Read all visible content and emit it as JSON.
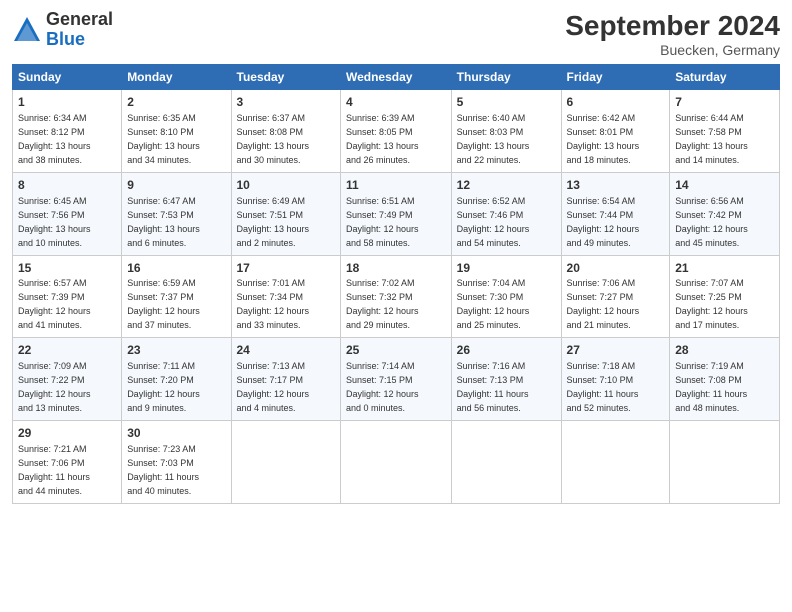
{
  "logo": {
    "general": "General",
    "blue": "Blue"
  },
  "title": "September 2024",
  "subtitle": "Buecken, Germany",
  "headers": [
    "Sunday",
    "Monday",
    "Tuesday",
    "Wednesday",
    "Thursday",
    "Friday",
    "Saturday"
  ],
  "weeks": [
    [
      {
        "day": "1",
        "info": "Sunrise: 6:34 AM\nSunset: 8:12 PM\nDaylight: 13 hours\nand 38 minutes."
      },
      {
        "day": "2",
        "info": "Sunrise: 6:35 AM\nSunset: 8:10 PM\nDaylight: 13 hours\nand 34 minutes."
      },
      {
        "day": "3",
        "info": "Sunrise: 6:37 AM\nSunset: 8:08 PM\nDaylight: 13 hours\nand 30 minutes."
      },
      {
        "day": "4",
        "info": "Sunrise: 6:39 AM\nSunset: 8:05 PM\nDaylight: 13 hours\nand 26 minutes."
      },
      {
        "day": "5",
        "info": "Sunrise: 6:40 AM\nSunset: 8:03 PM\nDaylight: 13 hours\nand 22 minutes."
      },
      {
        "day": "6",
        "info": "Sunrise: 6:42 AM\nSunset: 8:01 PM\nDaylight: 13 hours\nand 18 minutes."
      },
      {
        "day": "7",
        "info": "Sunrise: 6:44 AM\nSunset: 7:58 PM\nDaylight: 13 hours\nand 14 minutes."
      }
    ],
    [
      {
        "day": "8",
        "info": "Sunrise: 6:45 AM\nSunset: 7:56 PM\nDaylight: 13 hours\nand 10 minutes."
      },
      {
        "day": "9",
        "info": "Sunrise: 6:47 AM\nSunset: 7:53 PM\nDaylight: 13 hours\nand 6 minutes."
      },
      {
        "day": "10",
        "info": "Sunrise: 6:49 AM\nSunset: 7:51 PM\nDaylight: 13 hours\nand 2 minutes."
      },
      {
        "day": "11",
        "info": "Sunrise: 6:51 AM\nSunset: 7:49 PM\nDaylight: 12 hours\nand 58 minutes."
      },
      {
        "day": "12",
        "info": "Sunrise: 6:52 AM\nSunset: 7:46 PM\nDaylight: 12 hours\nand 54 minutes."
      },
      {
        "day": "13",
        "info": "Sunrise: 6:54 AM\nSunset: 7:44 PM\nDaylight: 12 hours\nand 49 minutes."
      },
      {
        "day": "14",
        "info": "Sunrise: 6:56 AM\nSunset: 7:42 PM\nDaylight: 12 hours\nand 45 minutes."
      }
    ],
    [
      {
        "day": "15",
        "info": "Sunrise: 6:57 AM\nSunset: 7:39 PM\nDaylight: 12 hours\nand 41 minutes."
      },
      {
        "day": "16",
        "info": "Sunrise: 6:59 AM\nSunset: 7:37 PM\nDaylight: 12 hours\nand 37 minutes."
      },
      {
        "day": "17",
        "info": "Sunrise: 7:01 AM\nSunset: 7:34 PM\nDaylight: 12 hours\nand 33 minutes."
      },
      {
        "day": "18",
        "info": "Sunrise: 7:02 AM\nSunset: 7:32 PM\nDaylight: 12 hours\nand 29 minutes."
      },
      {
        "day": "19",
        "info": "Sunrise: 7:04 AM\nSunset: 7:30 PM\nDaylight: 12 hours\nand 25 minutes."
      },
      {
        "day": "20",
        "info": "Sunrise: 7:06 AM\nSunset: 7:27 PM\nDaylight: 12 hours\nand 21 minutes."
      },
      {
        "day": "21",
        "info": "Sunrise: 7:07 AM\nSunset: 7:25 PM\nDaylight: 12 hours\nand 17 minutes."
      }
    ],
    [
      {
        "day": "22",
        "info": "Sunrise: 7:09 AM\nSunset: 7:22 PM\nDaylight: 12 hours\nand 13 minutes."
      },
      {
        "day": "23",
        "info": "Sunrise: 7:11 AM\nSunset: 7:20 PM\nDaylight: 12 hours\nand 9 minutes."
      },
      {
        "day": "24",
        "info": "Sunrise: 7:13 AM\nSunset: 7:17 PM\nDaylight: 12 hours\nand 4 minutes."
      },
      {
        "day": "25",
        "info": "Sunrise: 7:14 AM\nSunset: 7:15 PM\nDaylight: 12 hours\nand 0 minutes."
      },
      {
        "day": "26",
        "info": "Sunrise: 7:16 AM\nSunset: 7:13 PM\nDaylight: 11 hours\nand 56 minutes."
      },
      {
        "day": "27",
        "info": "Sunrise: 7:18 AM\nSunset: 7:10 PM\nDaylight: 11 hours\nand 52 minutes."
      },
      {
        "day": "28",
        "info": "Sunrise: 7:19 AM\nSunset: 7:08 PM\nDaylight: 11 hours\nand 48 minutes."
      }
    ],
    [
      {
        "day": "29",
        "info": "Sunrise: 7:21 AM\nSunset: 7:06 PM\nDaylight: 11 hours\nand 44 minutes."
      },
      {
        "day": "30",
        "info": "Sunrise: 7:23 AM\nSunset: 7:03 PM\nDaylight: 11 hours\nand 40 minutes."
      },
      null,
      null,
      null,
      null,
      null
    ]
  ]
}
